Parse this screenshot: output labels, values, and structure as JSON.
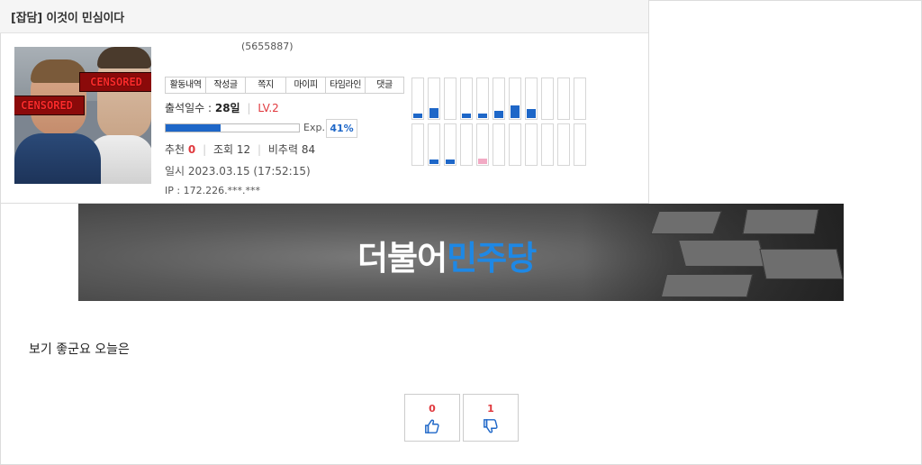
{
  "post": {
    "title": "[잡담] 이것이 민심이다",
    "body": "보기 좋군요 오늘은"
  },
  "author": {
    "id_text": "(5655887)",
    "avatar_censor_labels": [
      "CENSORED",
      "CENSORED"
    ],
    "menu": [
      "활동내역",
      "작성글",
      "쪽지",
      "마이피",
      "타임라인",
      "댓글"
    ],
    "attendance_label": "출석일수 :",
    "attendance_days": "28일",
    "level": "LV.2",
    "exp_label": "Exp.",
    "exp_percent_text": "41%",
    "exp_fraction": 0.41,
    "recommend_label": "추천",
    "recommend_value": "0",
    "views_label": "조회",
    "views_value": "12",
    "downvote_label": "비추력",
    "downvote_value": "84",
    "date_text": "일시 2023.03.15 (17:52:15)",
    "ip_text": "IP : 172.226.***.***"
  },
  "activity": {
    "row1_levels": [
      0.12,
      0.25,
      0,
      0.12,
      0.12,
      0.18,
      0.3,
      0.22,
      0,
      0,
      0
    ],
    "row2_levels": [
      0,
      0.12,
      0.12,
      0,
      0.14,
      0,
      0,
      0,
      0,
      0,
      0
    ],
    "row2_pink_index": 4,
    "bar_color": "#1e67c8",
    "pink_color": "#f2aac4"
  },
  "banner": {
    "text_white": "더불어",
    "text_blue": "민주당",
    "accent_color": "#1e88e5"
  },
  "votes": {
    "up_count": "0",
    "down_count": "1",
    "up_icon": "thumbs-up-icon",
    "down_icon": "thumbs-down-icon",
    "count_color": "#e0393e"
  }
}
